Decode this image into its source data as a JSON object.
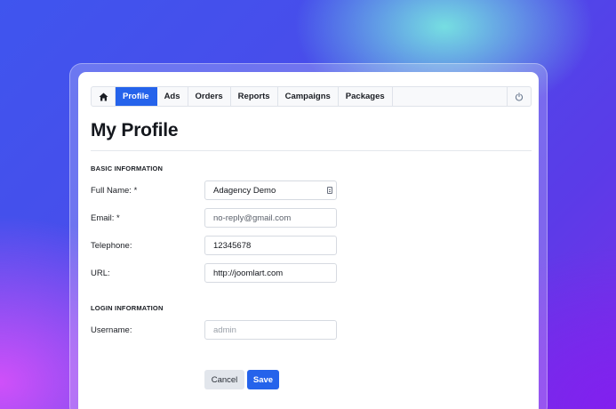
{
  "nav": {
    "home_icon": "home-icon",
    "items": [
      {
        "label": "Profile",
        "active": true
      },
      {
        "label": "Ads"
      },
      {
        "label": "Orders"
      },
      {
        "label": "Reports"
      },
      {
        "label": "Campaigns"
      },
      {
        "label": "Packages"
      }
    ],
    "power_icon": "power-icon"
  },
  "page": {
    "title": "My Profile"
  },
  "basic_info": {
    "heading": "BASIC INFORMATION",
    "full_name": {
      "label": "Full Name: *",
      "value": "Adagency Demo"
    },
    "email": {
      "label": "Email: *",
      "value": "no-reply@gmail.com"
    },
    "telephone": {
      "label": "Telephone:",
      "value": "12345678"
    },
    "url": {
      "label": "URL:",
      "value": "http://joomlart.com"
    }
  },
  "login_info": {
    "heading": "LOGIN INFORMATION",
    "username": {
      "label": "Username:",
      "placeholder": "admin"
    }
  },
  "actions": {
    "cancel": "Cancel",
    "save": "Save"
  },
  "colors": {
    "accent": "#2563eb",
    "card": "#ffffff"
  }
}
